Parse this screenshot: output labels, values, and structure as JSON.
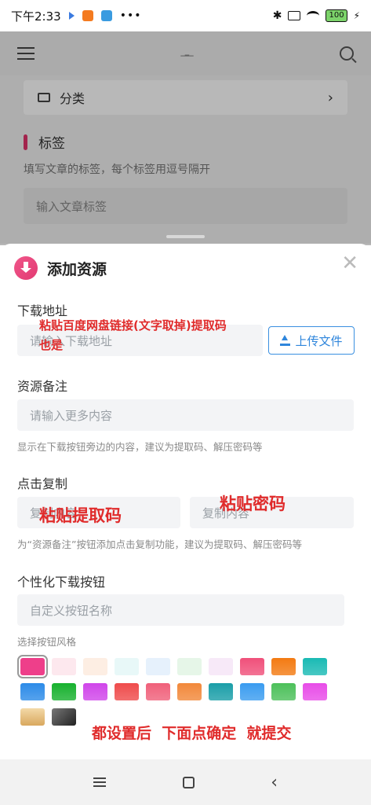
{
  "status_bar": {
    "time": "下午2:33",
    "battery": "100"
  },
  "background_page": {
    "category_label": "分类",
    "tags_title": "标签",
    "tags_hint": "填写文章的标签，每个标签用逗号隔开",
    "tags_placeholder": "输入文章标签"
  },
  "sheet": {
    "title": "添加资源",
    "download_url": {
      "label": "下载地址",
      "placeholder": "请输入下载地址",
      "upload_label": "上传文件"
    },
    "resource_note": {
      "label": "资源备注",
      "placeholder": "请输入更多内容",
      "hint": "显示在下载按钮旁边的内容，建议为提取码、解压密码等"
    },
    "click_copy": {
      "label": "点击复制",
      "placeholder_left": "复制内容",
      "placeholder_right": "复制内容",
      "hint": "为“资源备注”按钮添加点击复制功能，建议为提取码、解压密码等"
    },
    "custom_button": {
      "label": "个性化下载按钮",
      "placeholder": "自定义按钮名称",
      "style_label": "选择按钮风格"
    },
    "swatches": [
      "#ee3f8a",
      "#fde8ee",
      "#fdeee3",
      "#e8f8f8",
      "#e6f1fc",
      "#e6f6e8",
      "#f7e9f8",
      "#f0507a",
      "#f37a12",
      "#1abab4",
      "#2c8be8",
      "#17b12e",
      "#d045ea",
      "#ef4b4b",
      "#f0607a",
      "#f2883a",
      "#1a9ea8",
      "#3a9cf0",
      "#4cc05a",
      "#e84ce8",
      "#e8c48a",
      "#555555"
    ]
  },
  "annotations": {
    "paste_baidu": "粘贴百度网盘链接(文字取掉)提取码",
    "also_is": "也是",
    "paste_code": "粘贴提取码",
    "paste_password": "粘贴密码",
    "submit_note": "都设置后  下面点确定  就提交"
  }
}
